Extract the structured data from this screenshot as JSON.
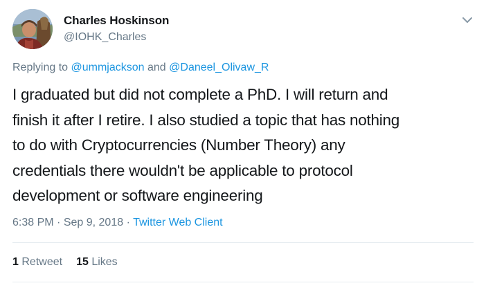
{
  "author": {
    "name": "Charles Hoskinson",
    "handle": "@IOHK_Charles"
  },
  "reply": {
    "prefix": "Replying to",
    "mention_1": "@ummjackson",
    "joiner": "and",
    "mention_2": "@Daneel_Olivaw_R"
  },
  "tweet": {
    "lines": [
      "I graduated but did not complete a PhD. I will return and",
      "finish it after I retire. I also studied a topic that has nothing",
      "to do with Cryptocurrencies (Number Theory) any",
      "credentials there wouldn't be applicable to protocol",
      "development or software engineering"
    ]
  },
  "meta": {
    "time": "6:38 PM",
    "separator": "·",
    "date": "Sep 9, 2018",
    "client": "Twitter Web Client"
  },
  "stats": {
    "retweet_count": "1",
    "retweet_label": "Retweet",
    "like_count": "15",
    "like_label": "Likes"
  },
  "colors": {
    "link": "#1b95e0",
    "secondary_text": "#657786",
    "primary_text": "#14171a",
    "divider": "#e6ecf0"
  },
  "icons": {
    "menu": "chevron-down-icon",
    "avatar": "profile-photo"
  }
}
